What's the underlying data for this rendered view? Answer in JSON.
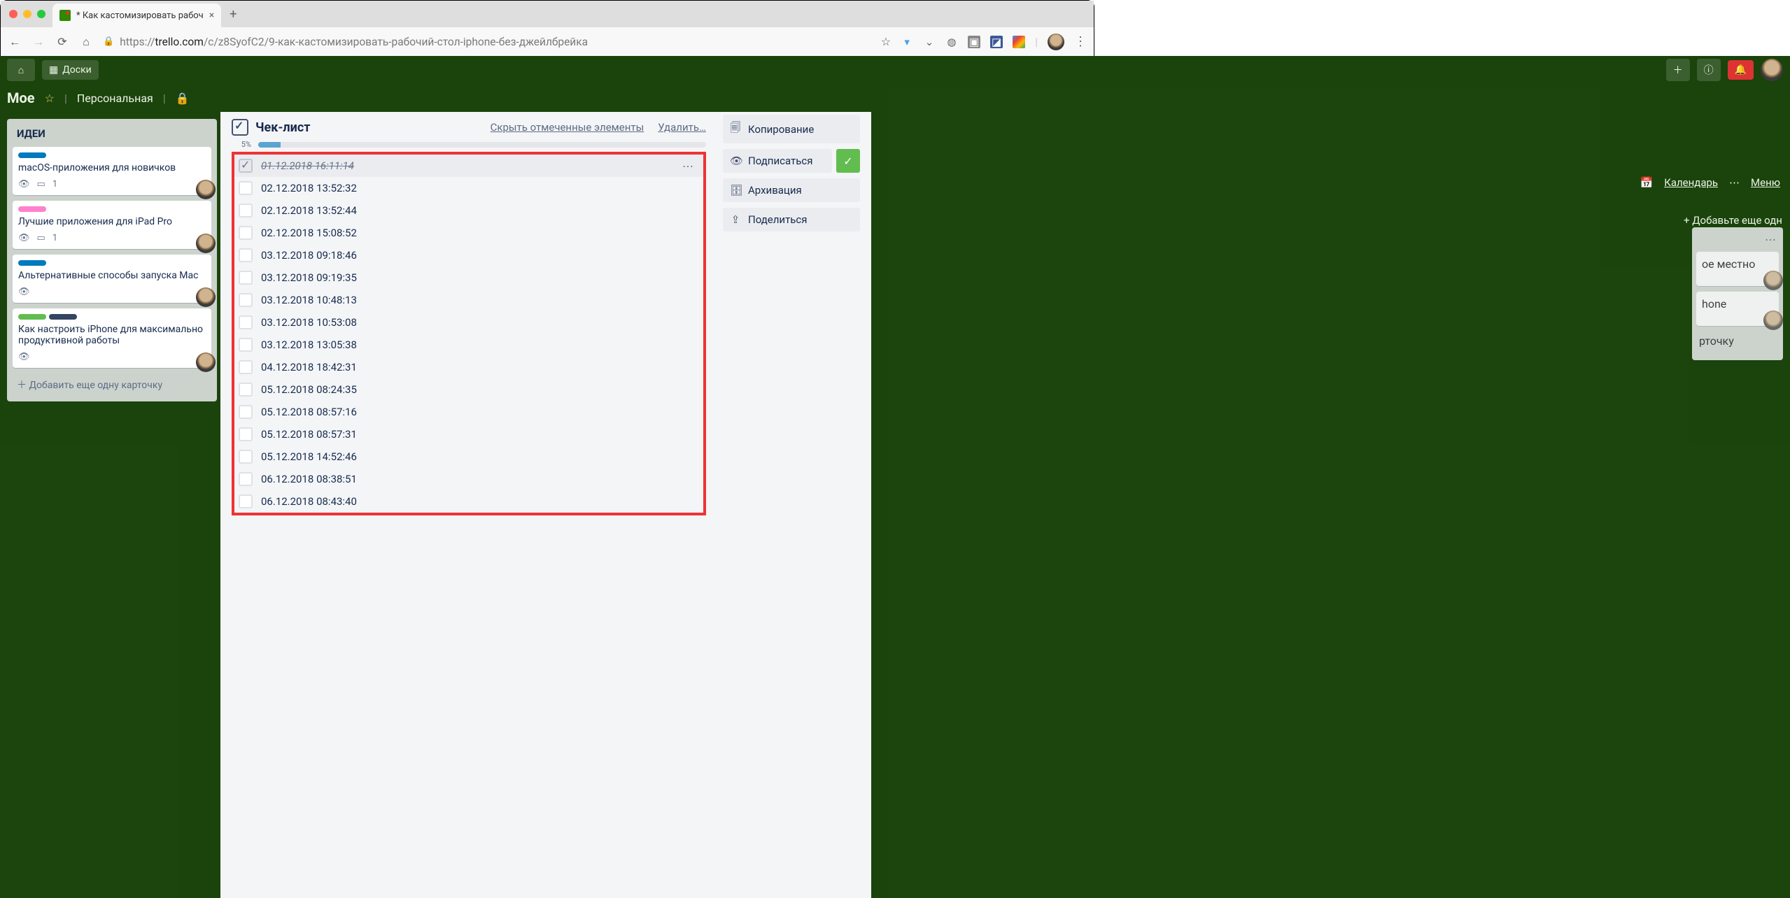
{
  "browser": {
    "tab_title": "* Как кастомизировать рабоч",
    "url_proto": "https://",
    "url_host": "trello.com",
    "url_path": "/c/z8SyofC2/9-как-кастомизировать-рабочий-стол-iphone-без-джейлбрейка"
  },
  "trello_header": {
    "boards_btn": "Доски"
  },
  "board": {
    "name": "Мое",
    "team": "Персональная",
    "calendar": "Календарь",
    "menu": "Меню"
  },
  "left_list": {
    "title": "ИДЕИ",
    "cards": [
      {
        "title": "macOS-приложения для новичков",
        "labels": [
          "blue"
        ],
        "count": "1"
      },
      {
        "title": "Лучшие приложения для iPad Pro",
        "labels": [
          "pink"
        ],
        "count": "1"
      },
      {
        "title": "Альтернативные способы запуска Mac",
        "labels": [
          "blue"
        ],
        "count": ""
      },
      {
        "title": "Как настроить iPhone для максимально продуктивной работы",
        "labels": [
          "green",
          "dark"
        ],
        "count": ""
      }
    ],
    "add_card": "Добавить еще одну карточку"
  },
  "right_fragments": {
    "card1": "ое местно",
    "card2": "hone",
    "card3": "рточку",
    "list_menu": "⋯",
    "add_list": "+ Добавьте еще одн"
  },
  "checklist": {
    "title": "Чек-лист",
    "hide_checked": "Скрыть отмеченные элементы",
    "delete": "Удалить…",
    "percent": "5%",
    "progress_width": "5%",
    "items": [
      {
        "text": "01.12.2018 16:11:14",
        "done": true
      },
      {
        "text": "02.12.2018 13:52:32",
        "done": false
      },
      {
        "text": "02.12.2018 13:52:44",
        "done": false
      },
      {
        "text": "02.12.2018 15:08:52",
        "done": false
      },
      {
        "text": "03.12.2018 09:18:46",
        "done": false
      },
      {
        "text": "03.12.2018 09:19:35",
        "done": false
      },
      {
        "text": "03.12.2018 10:48:13",
        "done": false
      },
      {
        "text": "03.12.2018 10:53:08",
        "done": false
      },
      {
        "text": "03.12.2018 13:05:38",
        "done": false
      },
      {
        "text": "04.12.2018 18:42:31",
        "done": false
      },
      {
        "text": "05.12.2018 08:24:35",
        "done": false
      },
      {
        "text": "05.12.2018 08:57:16",
        "done": false
      },
      {
        "text": "05.12.2018 08:57:31",
        "done": false
      },
      {
        "text": "05.12.2018 14:52:46",
        "done": false
      },
      {
        "text": "06.12.2018 08:38:51",
        "done": false
      },
      {
        "text": "06.12.2018 08:43:40",
        "done": false
      }
    ]
  },
  "sidebar_actions": {
    "copy": "Копирование",
    "subscribe": "Подписаться",
    "archive": "Архивация",
    "share": "Поделиться"
  }
}
